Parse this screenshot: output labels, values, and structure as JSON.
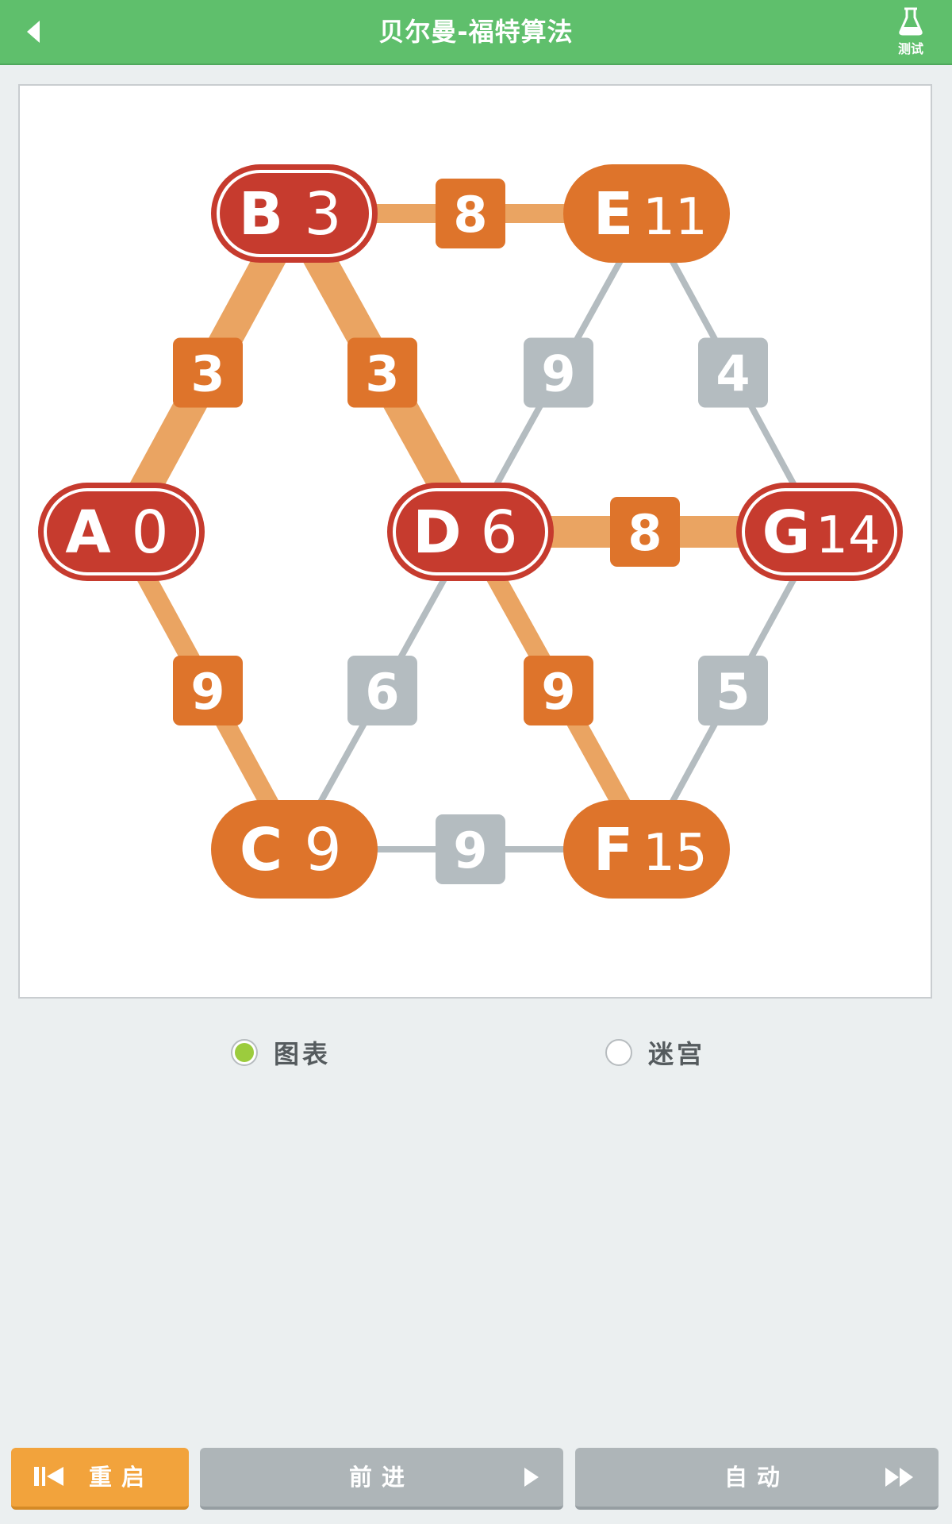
{
  "header": {
    "title": "贝尔曼-福特算法",
    "test_label": "测试",
    "back_icon": "chevron-left-icon",
    "test_icon": "flask-icon"
  },
  "graph": {
    "nodes": [
      {
        "id": "A",
        "label": "A",
        "value": "0",
        "state": "settled"
      },
      {
        "id": "B",
        "label": "B",
        "value": "3",
        "state": "settled"
      },
      {
        "id": "C",
        "label": "C",
        "value": "9",
        "state": "reached"
      },
      {
        "id": "D",
        "label": "D",
        "value": "6",
        "state": "settled"
      },
      {
        "id": "E",
        "label": "E",
        "value": "11",
        "state": "reached"
      },
      {
        "id": "F",
        "label": "F",
        "value": "15",
        "state": "reached"
      },
      {
        "id": "G",
        "label": "G",
        "value": "14",
        "state": "settled"
      }
    ],
    "edges": [
      {
        "from": "B",
        "to": "E",
        "weight": "8",
        "state": "relaxed"
      },
      {
        "from": "A",
        "to": "B",
        "weight": "3",
        "state": "path"
      },
      {
        "from": "B",
        "to": "D",
        "weight": "3",
        "state": "path"
      },
      {
        "from": "E",
        "to": "D",
        "weight": "9",
        "state": "idle"
      },
      {
        "from": "E",
        "to": "G",
        "weight": "4",
        "state": "idle"
      },
      {
        "from": "D",
        "to": "G",
        "weight": "8",
        "state": "path"
      },
      {
        "from": "A",
        "to": "C",
        "weight": "9",
        "state": "relaxed"
      },
      {
        "from": "D",
        "to": "C",
        "weight": "6",
        "state": "idle"
      },
      {
        "from": "D",
        "to": "F",
        "weight": "9",
        "state": "relaxed"
      },
      {
        "from": "G",
        "to": "F",
        "weight": "5",
        "state": "idle"
      },
      {
        "from": "C",
        "to": "F",
        "weight": "9",
        "state": "idle"
      }
    ]
  },
  "modes": {
    "graph_label": "图表",
    "maze_label": "迷宫",
    "selected": "graph"
  },
  "controls": {
    "restart_label": "重启",
    "forward_label": "前进",
    "auto_label": "自动",
    "restart_icon": "skip-back-icon",
    "forward_icon": "play-icon",
    "auto_icon": "fast-forward-icon"
  },
  "colors": {
    "header": "#5fbf6c",
    "settled_node": "#c63b2e",
    "reached_node": "#de742b",
    "path_edge": "#eaa462",
    "idle_edge": "#b4bcc0",
    "weight_badge_active": "#de742b",
    "weight_badge_idle": "#b4bcc0",
    "restart_button": "#f2a33c",
    "disabled_button": "#aeb5b8",
    "radio_selected": "#9ccc3d"
  }
}
